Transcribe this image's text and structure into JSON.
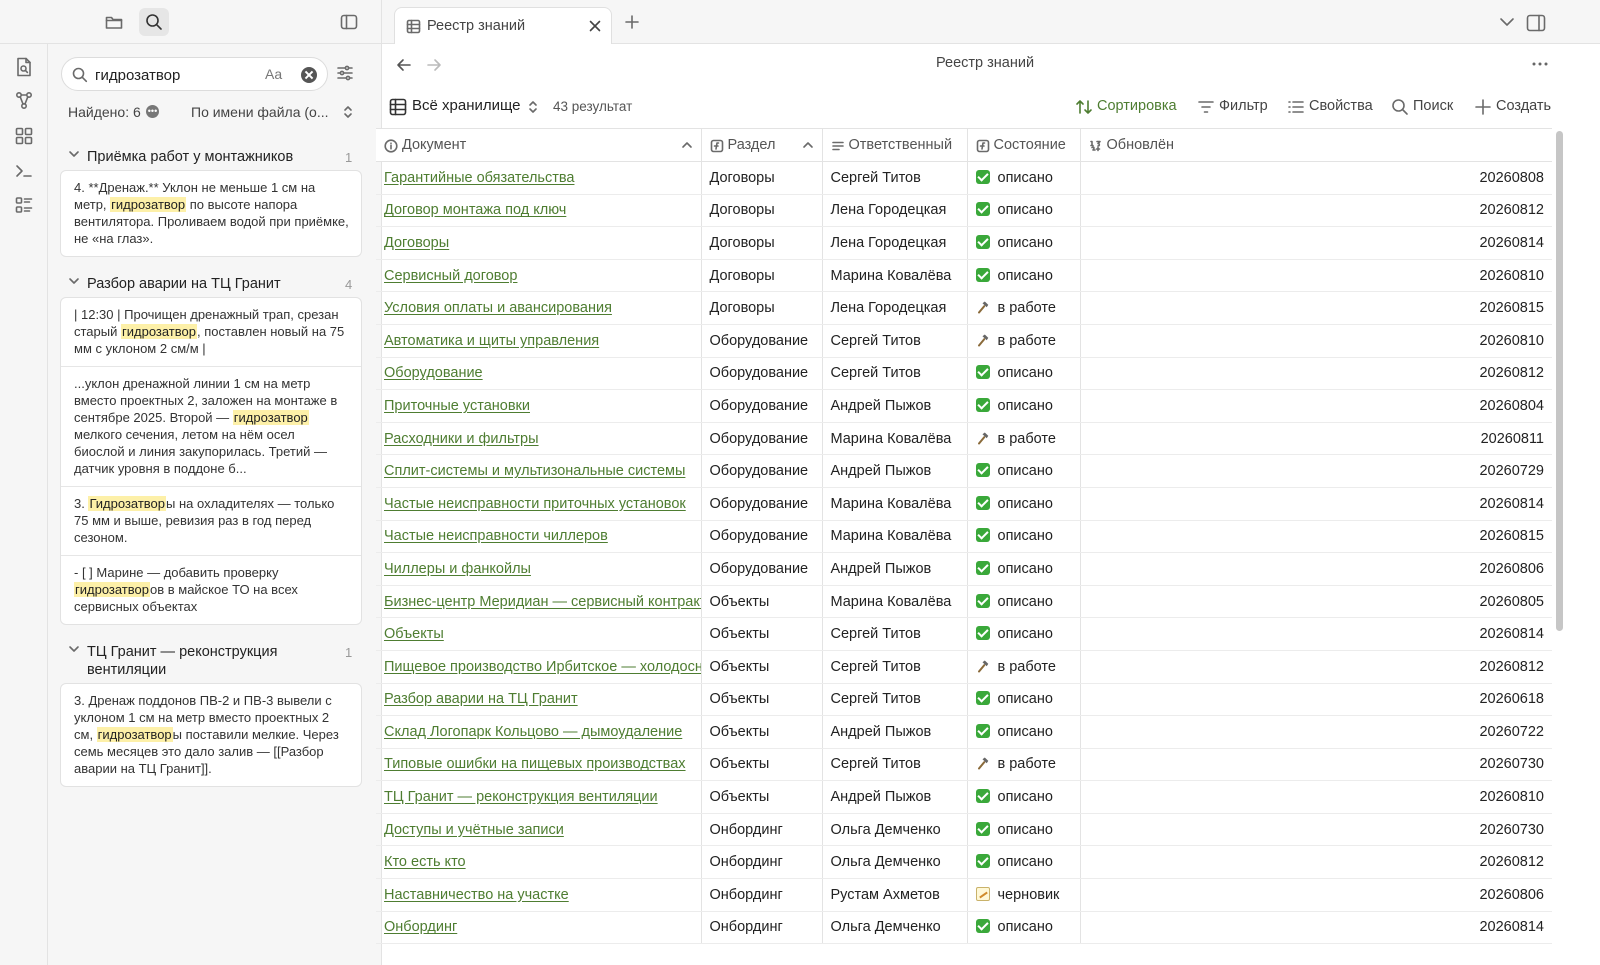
{
  "left_top": {
    "files_icon": "folder-icon",
    "search_icon": "search-icon",
    "toggle_icon": "sidebar-toggle-icon"
  },
  "ribbon": {
    "icons": [
      "file-search-icon",
      "graph-icon",
      "blocks-icon",
      "terminal-icon",
      "list-icon"
    ]
  },
  "search": {
    "query": "гидрозатвор",
    "case_toggle": "Aa",
    "found": "Найдено: 6",
    "sort_select": "По имени файла (о...",
    "groups": [
      {
        "title": "Приёмка работ у монтажников",
        "count": "1",
        "matches": [
          {
            "before": "4. **Дренаж.** Уклон не меньше 1 см на метр, ",
            "hl": "гидрозатвор",
            "after": " по высоте напора вентилятора. Проливаем водой при приёмке, не «на глаз»."
          }
        ]
      },
      {
        "title": "Разбор аварии на ТЦ Гранит",
        "count": "4",
        "matches": [
          {
            "before": "| 12:30 | Прочищен дренажный трап, срезан старый ",
            "hl": "гидрозатвор",
            "after": ", поставлен новый на 75 мм с уклоном 2 см/м |"
          },
          {
            "before": "...уклон дренажной линии 1 см на метр вместо проектных 2, заложен на монтаже в сентябре 2025. Второй — ",
            "hl": "гидрозатвор",
            "after": " мелкого сечения, летом на нём осел биослой и линия закупорилась. Третий — датчик уровня в поддоне б..."
          },
          {
            "before": "3. ",
            "hl": "Гидрозатвор",
            "after": "ы на охладителях — только 75 мм и выше, ревизия раз в год перед сезоном."
          },
          {
            "before": "- [ ] Марине — добавить проверку ",
            "hl": "гидрозатвор",
            "after": "ов в майское ТО на всех сервисных объектах"
          }
        ]
      },
      {
        "title": "ТЦ Гранит — реконструкция вентиляции",
        "count": "1",
        "matches": [
          {
            "before": "3. Дренаж поддонов ПВ-2 и ПВ-3 вывели с уклоном 1 см на метр вместо проектных 2 см, ",
            "hl": "гидрозатвор",
            "after": "ы поставили мелкие. Через семь месяцев это дало залив — [[Разбор аварии на ТЦ Гранит]]."
          }
        ]
      }
    ]
  },
  "tab": {
    "title": "Реестр знаний"
  },
  "view": {
    "title": "Реестр знаний"
  },
  "toolbar": {
    "vault": "Всё хранилище",
    "count": "43 результат",
    "sort": "Сортировка",
    "filter": "Фильтр",
    "properties": "Свойства",
    "search": "Поиск",
    "create": "Создать"
  },
  "table": {
    "columns": [
      "Документ",
      "Раздел",
      "Ответственный",
      "Состояние",
      "Обновлён"
    ],
    "rows": [
      [
        "Гарантийные обязательства",
        "Договоры",
        "Сергей Титов",
        "done",
        "описано",
        "20260808"
      ],
      [
        "Договор монтажа под ключ",
        "Договоры",
        "Лена Городецкая",
        "done",
        "описано",
        "20260812"
      ],
      [
        "Договоры",
        "Договоры",
        "Лена Городецкая",
        "done",
        "описано",
        "20260814"
      ],
      [
        "Сервисный договор",
        "Договоры",
        "Марина Ковалёва",
        "done",
        "описано",
        "20260810"
      ],
      [
        "Условия оплаты и авансирования",
        "Договоры",
        "Лена Городецкая",
        "work",
        "в работе",
        "20260815"
      ],
      [
        "Автоматика и щиты управления",
        "Оборудование",
        "Сергей Титов",
        "work",
        "в работе",
        "20260810"
      ],
      [
        "Оборудование",
        "Оборудование",
        "Сергей Титов",
        "done",
        "описано",
        "20260812"
      ],
      [
        "Приточные установки",
        "Оборудование",
        "Андрей Пыжов",
        "done",
        "описано",
        "20260804"
      ],
      [
        "Расходники и фильтры",
        "Оборудование",
        "Марина Ковалёва",
        "work",
        "в работе",
        "20260811"
      ],
      [
        "Сплит-системы и мультизональные системы",
        "Оборудование",
        "Андрей Пыжов",
        "done",
        "описано",
        "20260729"
      ],
      [
        "Частые неисправности приточных установок",
        "Оборудование",
        "Марина Ковалёва",
        "done",
        "описано",
        "20260814"
      ],
      [
        "Частые неисправности чиллеров",
        "Оборудование",
        "Марина Ковалёва",
        "done",
        "описано",
        "20260815"
      ],
      [
        "Чиллеры и фанкойлы",
        "Оборудование",
        "Андрей Пыжов",
        "done",
        "описано",
        "20260806"
      ],
      [
        "Бизнес-центр Меридиан — сервисный контракт",
        "Объекты",
        "Марина Ковалёва",
        "done",
        "описано",
        "20260805"
      ],
      [
        "Объекты",
        "Объекты",
        "Сергей Титов",
        "done",
        "описано",
        "20260814"
      ],
      [
        "Пищевое производство Ирбитское — холодоснабжение",
        "Объекты",
        "Сергей Титов",
        "work",
        "в работе",
        "20260812"
      ],
      [
        "Разбор аварии на ТЦ Гранит",
        "Объекты",
        "Сергей Титов",
        "done",
        "описано",
        "20260618"
      ],
      [
        "Склад Логопарк Кольцово — дымоудаление",
        "Объекты",
        "Андрей Пыжов",
        "done",
        "описано",
        "20260722"
      ],
      [
        "Типовые ошибки на пищевых производствах",
        "Объекты",
        "Сергей Титов",
        "work",
        "в работе",
        "20260730"
      ],
      [
        "ТЦ Гранит — реконструкция вентиляции",
        "Объекты",
        "Андрей Пыжов",
        "done",
        "описано",
        "20260810"
      ],
      [
        "Доступы и учётные записи",
        "Онбординг",
        "Ольга Демченко",
        "done",
        "описано",
        "20260730"
      ],
      [
        "Кто есть кто",
        "Онбординг",
        "Ольга Демченко",
        "done",
        "описано",
        "20260812"
      ],
      [
        "Наставничество на участке",
        "Онбординг",
        "Рустам Ахметов",
        "draft",
        "черновик",
        "20260806"
      ],
      [
        "Онбординг",
        "Онбординг",
        "Ольга Демченко",
        "done",
        "описано",
        "20260814"
      ]
    ]
  }
}
